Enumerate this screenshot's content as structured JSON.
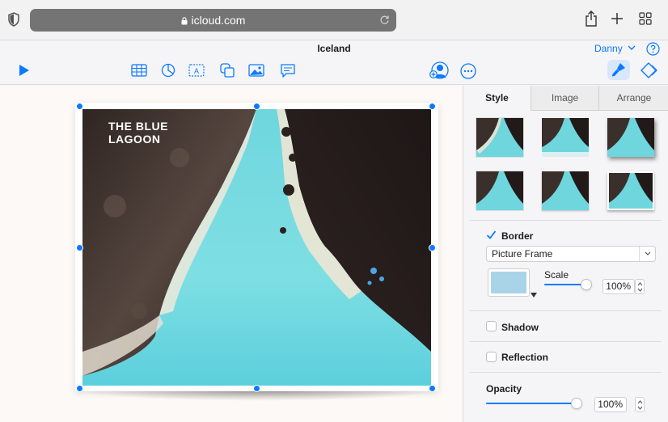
{
  "browser": {
    "url": "icloud.com"
  },
  "app": {
    "document_title": "Iceland",
    "user_name": "Danny"
  },
  "canvas": {
    "photo_caption": "THE BLUE\nLAGOON"
  },
  "inspector": {
    "tabs": [
      {
        "label": "Style",
        "active": true
      },
      {
        "label": "Image",
        "active": false
      },
      {
        "label": "Arrange",
        "active": false
      }
    ],
    "border": {
      "label": "Border",
      "checked": true,
      "style_value": "Picture Frame",
      "scale_label": "Scale",
      "scale_value": "100%",
      "scale_level": 1.0,
      "color": "#a9d4e8"
    },
    "shadow": {
      "label": "Shadow",
      "checked": false
    },
    "reflection": {
      "label": "Reflection",
      "checked": false
    },
    "opacity": {
      "label": "Opacity",
      "value": "100%",
      "level": 1.0
    }
  },
  "colors": {
    "accent": "#0a7aff",
    "url_bar": "#747474",
    "water": "#7fd8e0",
    "rock": "#3a2e2a"
  },
  "icons": [
    "privacy-shield-icon",
    "lock-icon",
    "reload-icon",
    "share-icon",
    "plus-icon",
    "tab-overview-icon",
    "help-icon",
    "play-icon",
    "table-icon",
    "chart-icon",
    "text-box-icon",
    "shape-icon",
    "media-icon",
    "comment-icon",
    "collaborate-icon",
    "more-icon",
    "format-brush-icon",
    "animate-icon"
  ]
}
